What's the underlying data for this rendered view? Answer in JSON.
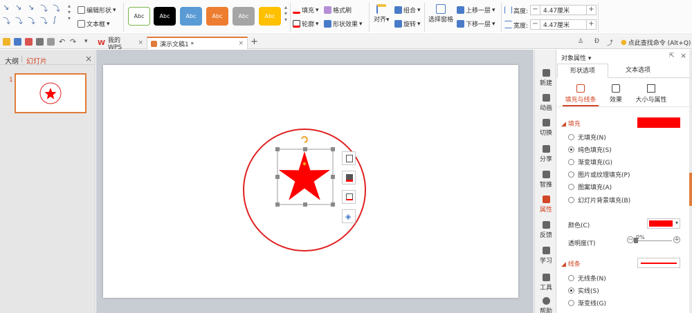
{
  "ribbon": {
    "edit_shape": "编辑形状",
    "text_box": "文本框",
    "style_label": "Abc",
    "fill": "填充",
    "format_painter": "格式刷",
    "outline": "轮廓",
    "shape_effect": "形状效果",
    "align": "对齐",
    "group": "组合",
    "rotate": "旋转",
    "selection_pane": "选择窗格",
    "bring_forward": "上移一层",
    "send_backward": "下移一层",
    "height_label": "高度:",
    "height_value": "4.47厘米",
    "width_label": "宽度:",
    "width_value": "4.47厘米",
    "minus": "−",
    "plus": "+"
  },
  "toolbar": {
    "tab_wps": "我的WPS",
    "tab_doc": "演示文稿1 *",
    "new_tab": "+",
    "search_command": "点此查找命令 (Alt+Q)"
  },
  "left_pane": {
    "tab_outline": "大纲",
    "tab_slides": "幻灯片",
    "slide_number": "1"
  },
  "right_strip": {
    "items": [
      "新建",
      "动画",
      "切换",
      "分享",
      "智推",
      "属性",
      "反馈",
      "学习",
      "工具",
      "帮助"
    ]
  },
  "properties": {
    "title": "对象属性",
    "tab_shape": "形状选项",
    "tab_text": "文本选项",
    "sub_fill_line": "填充与线条",
    "sub_effect": "效果",
    "sub_size": "大小与属性",
    "section_fill": "填充",
    "fill_options": [
      "无填充(N)",
      "纯色填充(S)",
      "渐变填充(G)",
      "图片或纹理填充(P)",
      "图案填充(A)",
      "幻灯片背景填充(B)"
    ],
    "color_label": "颜色(C)",
    "transparency_label": "透明度(T)",
    "transparency_value": "0%",
    "section_line": "线条",
    "line_options": [
      "无线条(N)",
      "实线(S)",
      "渐变线(G)"
    ]
  },
  "colors": {
    "accent": "#d24726",
    "fill_red": "#ff0000",
    "circle_red": "#e02020"
  }
}
